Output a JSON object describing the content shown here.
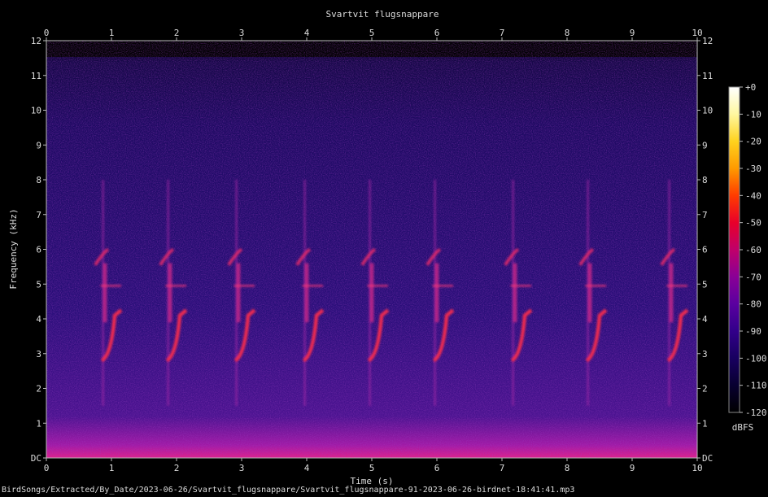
{
  "chart_data": {
    "type": "heatmap",
    "title": "Svartvit flugsnappare",
    "xlabel": "Time (s)",
    "ylabel": "Frequency (kHz)",
    "xlim": [
      0,
      10
    ],
    "ylim": [
      0,
      12
    ],
    "x_ticks": [
      "0",
      "1",
      "2",
      "3",
      "4",
      "5",
      "6",
      "7",
      "8",
      "9",
      "10"
    ],
    "y_ticks": [
      "DC",
      "1",
      "2",
      "3",
      "4",
      "5",
      "6",
      "7",
      "8",
      "9",
      "10",
      "11",
      "12"
    ],
    "colorbar": {
      "label": "dBFS",
      "range": [
        -120,
        0
      ],
      "ticks": [
        "+0",
        "-10",
        "-20",
        "-30",
        "-40",
        "-50",
        "-60",
        "-70",
        "-80",
        "-90",
        "-100",
        "-110",
        "-120"
      ],
      "colors": [
        "#ffffff",
        "#fff8a0",
        "#ffd21e",
        "#ff9a00",
        "#ff3c00",
        "#e8002a",
        "#c0006a",
        "#8a0096",
        "#5a00a0",
        "#32008a",
        "#180060",
        "#080030",
        "#000000"
      ]
    },
    "song_phrase_start_times_s": [
      0.85,
      1.85,
      2.9,
      3.95,
      4.95,
      5.95,
      7.15,
      8.3,
      9.55
    ]
  },
  "footer_path": "BirdSongs/Extracted/By_Date/2023-06-26/Svartvit_flugsnappare/Svartvit_flugsnappare-91-2023-06-26-birdnet-18:41:41.mp3"
}
